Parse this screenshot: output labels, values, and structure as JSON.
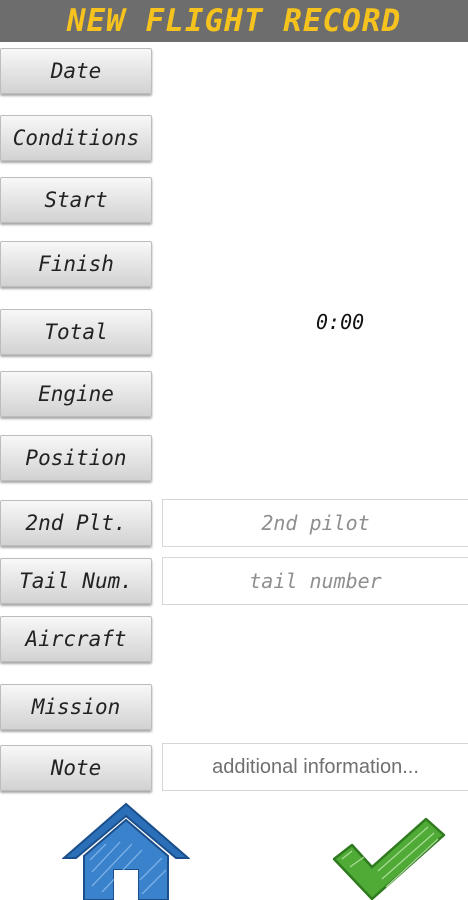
{
  "header": {
    "title": "NEW FLIGHT RECORD"
  },
  "form": {
    "buttons": {
      "date": "Date",
      "conditions": "Conditions",
      "start": "Start",
      "finish": "Finish",
      "total": "Total",
      "engine": "Engine",
      "position": "Position",
      "second_pilot": "2nd Plt.",
      "tail_number": "Tail Num.",
      "aircraft": "Aircraft",
      "mission": "Mission",
      "note": "Note"
    },
    "total_value": "0:00",
    "inputs": {
      "second_pilot": {
        "value": "",
        "placeholder": "2nd pilot"
      },
      "tail_number": {
        "value": "",
        "placeholder": "tail number"
      },
      "note": {
        "value": "",
        "placeholder": "additional information..."
      }
    }
  },
  "footer": {
    "home_icon": "home-icon",
    "confirm_icon": "checkmark-icon",
    "colors": {
      "home": "#2a6fb8",
      "confirm": "#3f9b2c"
    }
  },
  "colors": {
    "title_bar": "#6d6d6d",
    "title_text": "#f6c21d"
  }
}
